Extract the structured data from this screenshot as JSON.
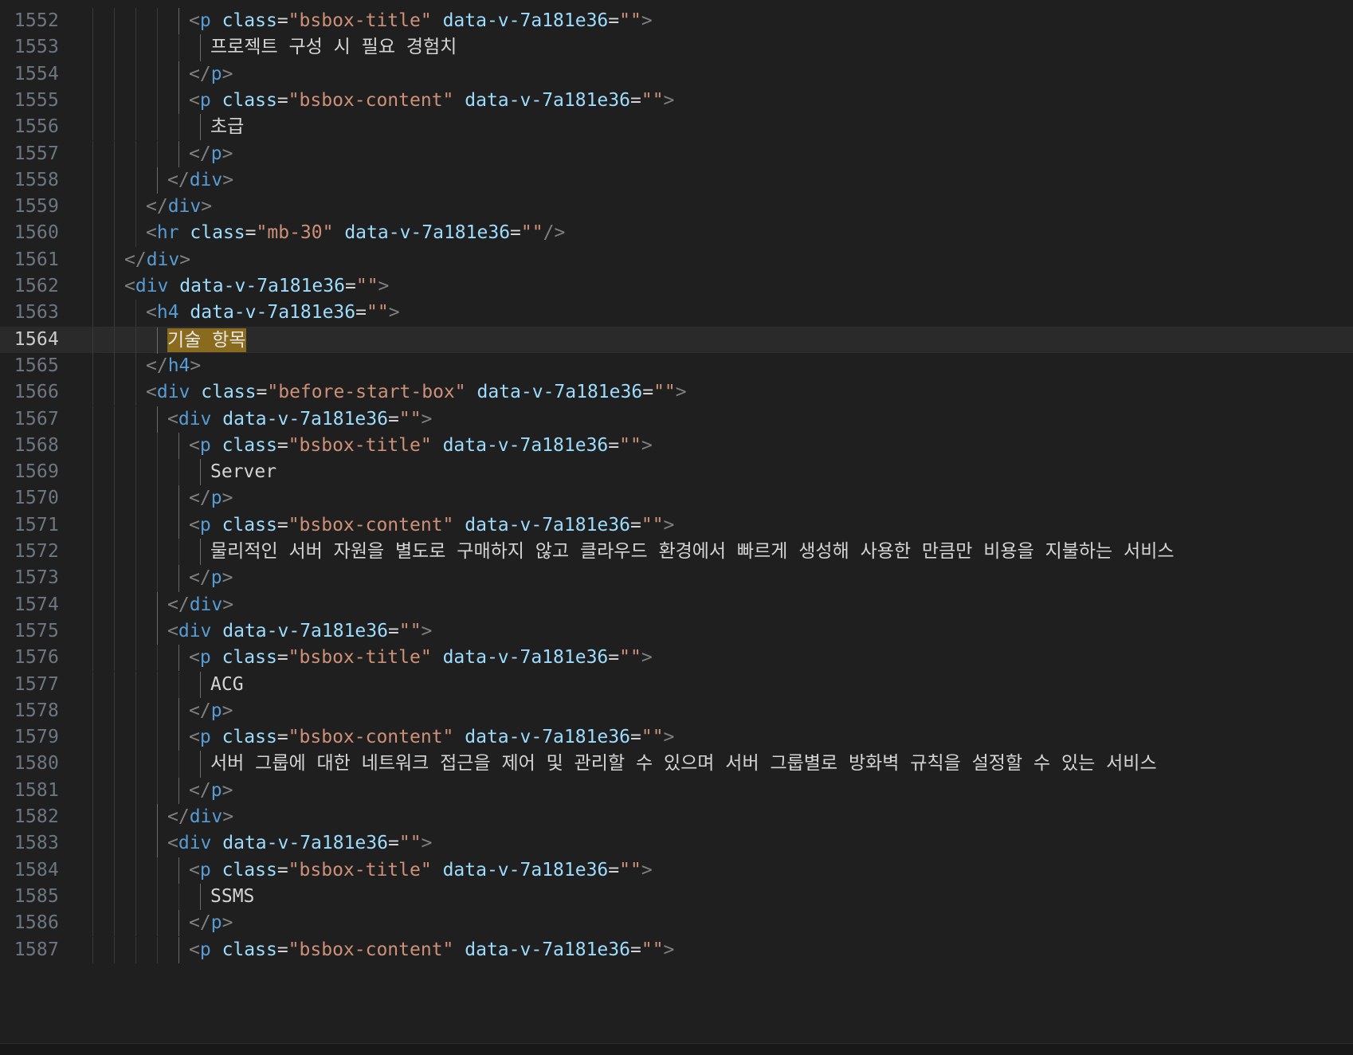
{
  "editor": {
    "current_line": 1564,
    "selected_text": "기술 항목",
    "lines": [
      {
        "num": "1552",
        "indent": 5,
        "tokens": [
          [
            "<",
            "punc"
          ],
          [
            "p",
            "tag"
          ],
          [
            " ",
            "text"
          ],
          [
            "class",
            "attr"
          ],
          [
            "=",
            "eq"
          ],
          [
            "\"bsbox-title\"",
            "str"
          ],
          [
            " ",
            "text"
          ],
          [
            "data-v-7a181e36",
            "attr"
          ],
          [
            "=",
            "eq"
          ],
          [
            "\"\"",
            "str"
          ],
          [
            ">",
            "punc"
          ]
        ]
      },
      {
        "num": "1553",
        "indent": 6,
        "tokens": [
          [
            "프로젝트 구성 시 필요 경험치",
            "text"
          ]
        ]
      },
      {
        "num": "1554",
        "indent": 5,
        "tokens": [
          [
            "</",
            "punc"
          ],
          [
            "p",
            "tag"
          ],
          [
            ">",
            "punc"
          ]
        ]
      },
      {
        "num": "1555",
        "indent": 5,
        "tokens": [
          [
            "<",
            "punc"
          ],
          [
            "p",
            "tag"
          ],
          [
            " ",
            "text"
          ],
          [
            "class",
            "attr"
          ],
          [
            "=",
            "eq"
          ],
          [
            "\"bsbox-content\"",
            "str"
          ],
          [
            " ",
            "text"
          ],
          [
            "data-v-7a181e36",
            "attr"
          ],
          [
            "=",
            "eq"
          ],
          [
            "\"\"",
            "str"
          ],
          [
            ">",
            "punc"
          ]
        ]
      },
      {
        "num": "1556",
        "indent": 6,
        "tokens": [
          [
            "초급",
            "text"
          ]
        ]
      },
      {
        "num": "1557",
        "indent": 5,
        "tokens": [
          [
            "</",
            "punc"
          ],
          [
            "p",
            "tag"
          ],
          [
            ">",
            "punc"
          ]
        ]
      },
      {
        "num": "1558",
        "indent": 4,
        "tokens": [
          [
            "</",
            "punc"
          ],
          [
            "div",
            "tag"
          ],
          [
            ">",
            "punc"
          ]
        ]
      },
      {
        "num": "1559",
        "indent": 3,
        "tokens": [
          [
            "</",
            "punc"
          ],
          [
            "div",
            "tag"
          ],
          [
            ">",
            "punc"
          ]
        ]
      },
      {
        "num": "1560",
        "indent": 3,
        "tokens": [
          [
            "<",
            "punc"
          ],
          [
            "hr",
            "tag"
          ],
          [
            " ",
            "text"
          ],
          [
            "class",
            "attr"
          ],
          [
            "=",
            "eq"
          ],
          [
            "\"mb-30\"",
            "str"
          ],
          [
            " ",
            "text"
          ],
          [
            "data-v-7a181e36",
            "attr"
          ],
          [
            "=",
            "eq"
          ],
          [
            "\"\"",
            "str"
          ],
          [
            "/>",
            "punc"
          ]
        ]
      },
      {
        "num": "1561",
        "indent": 2,
        "tokens": [
          [
            "</",
            "punc"
          ],
          [
            "div",
            "tag"
          ],
          [
            ">",
            "punc"
          ]
        ]
      },
      {
        "num": "1562",
        "indent": 2,
        "tokens": [
          [
            "<",
            "punc"
          ],
          [
            "div",
            "tag"
          ],
          [
            " ",
            "text"
          ],
          [
            "data-v-7a181e36",
            "attr"
          ],
          [
            "=",
            "eq"
          ],
          [
            "\"\"",
            "str"
          ],
          [
            ">",
            "punc"
          ]
        ]
      },
      {
        "num": "1563",
        "indent": 3,
        "tokens": [
          [
            "<",
            "punc"
          ],
          [
            "h4",
            "tag"
          ],
          [
            " ",
            "text"
          ],
          [
            "data-v-7a181e36",
            "attr"
          ],
          [
            "=",
            "eq"
          ],
          [
            "\"\"",
            "str"
          ],
          [
            ">",
            "punc"
          ]
        ]
      },
      {
        "num": "1564",
        "indent": 4,
        "tokens": [
          [
            "기술 항목",
            "hl"
          ]
        ]
      },
      {
        "num": "1565",
        "indent": 3,
        "tokens": [
          [
            "</",
            "punc"
          ],
          [
            "h4",
            "tag"
          ],
          [
            ">",
            "punc"
          ]
        ]
      },
      {
        "num": "1566",
        "indent": 3,
        "tokens": [
          [
            "<",
            "punc"
          ],
          [
            "div",
            "tag"
          ],
          [
            " ",
            "text"
          ],
          [
            "class",
            "attr"
          ],
          [
            "=",
            "eq"
          ],
          [
            "\"before-start-box\"",
            "str"
          ],
          [
            " ",
            "text"
          ],
          [
            "data-v-7a181e36",
            "attr"
          ],
          [
            "=",
            "eq"
          ],
          [
            "\"\"",
            "str"
          ],
          [
            ">",
            "punc"
          ]
        ]
      },
      {
        "num": "1567",
        "indent": 4,
        "tokens": [
          [
            "<",
            "punc"
          ],
          [
            "div",
            "tag"
          ],
          [
            " ",
            "text"
          ],
          [
            "data-v-7a181e36",
            "attr"
          ],
          [
            "=",
            "eq"
          ],
          [
            "\"\"",
            "str"
          ],
          [
            ">",
            "punc"
          ]
        ]
      },
      {
        "num": "1568",
        "indent": 5,
        "tokens": [
          [
            "<",
            "punc"
          ],
          [
            "p",
            "tag"
          ],
          [
            " ",
            "text"
          ],
          [
            "class",
            "attr"
          ],
          [
            "=",
            "eq"
          ],
          [
            "\"bsbox-title\"",
            "str"
          ],
          [
            " ",
            "text"
          ],
          [
            "data-v-7a181e36",
            "attr"
          ],
          [
            "=",
            "eq"
          ],
          [
            "\"\"",
            "str"
          ],
          [
            ">",
            "punc"
          ]
        ]
      },
      {
        "num": "1569",
        "indent": 6,
        "tokens": [
          [
            "Server",
            "text"
          ]
        ]
      },
      {
        "num": "1570",
        "indent": 5,
        "tokens": [
          [
            "</",
            "punc"
          ],
          [
            "p",
            "tag"
          ],
          [
            ">",
            "punc"
          ]
        ]
      },
      {
        "num": "1571",
        "indent": 5,
        "tokens": [
          [
            "<",
            "punc"
          ],
          [
            "p",
            "tag"
          ],
          [
            " ",
            "text"
          ],
          [
            "class",
            "attr"
          ],
          [
            "=",
            "eq"
          ],
          [
            "\"bsbox-content\"",
            "str"
          ],
          [
            " ",
            "text"
          ],
          [
            "data-v-7a181e36",
            "attr"
          ],
          [
            "=",
            "eq"
          ],
          [
            "\"\"",
            "str"
          ],
          [
            ">",
            "punc"
          ]
        ]
      },
      {
        "num": "1572",
        "indent": 6,
        "tokens": [
          [
            "물리적인 서버 자원을 별도로 구매하지 않고 클라우드 환경에서 빠르게 생성해 사용한 만큼만 비용을 지불하는 서비스",
            "text"
          ]
        ]
      },
      {
        "num": "1573",
        "indent": 5,
        "tokens": [
          [
            "</",
            "punc"
          ],
          [
            "p",
            "tag"
          ],
          [
            ">",
            "punc"
          ]
        ]
      },
      {
        "num": "1574",
        "indent": 4,
        "tokens": [
          [
            "</",
            "punc"
          ],
          [
            "div",
            "tag"
          ],
          [
            ">",
            "punc"
          ]
        ]
      },
      {
        "num": "1575",
        "indent": 4,
        "tokens": [
          [
            "<",
            "punc"
          ],
          [
            "div",
            "tag"
          ],
          [
            " ",
            "text"
          ],
          [
            "data-v-7a181e36",
            "attr"
          ],
          [
            "=",
            "eq"
          ],
          [
            "\"\"",
            "str"
          ],
          [
            ">",
            "punc"
          ]
        ]
      },
      {
        "num": "1576",
        "indent": 5,
        "tokens": [
          [
            "<",
            "punc"
          ],
          [
            "p",
            "tag"
          ],
          [
            " ",
            "text"
          ],
          [
            "class",
            "attr"
          ],
          [
            "=",
            "eq"
          ],
          [
            "\"bsbox-title\"",
            "str"
          ],
          [
            " ",
            "text"
          ],
          [
            "data-v-7a181e36",
            "attr"
          ],
          [
            "=",
            "eq"
          ],
          [
            "\"\"",
            "str"
          ],
          [
            ">",
            "punc"
          ]
        ]
      },
      {
        "num": "1577",
        "indent": 6,
        "tokens": [
          [
            "ACG",
            "text"
          ]
        ]
      },
      {
        "num": "1578",
        "indent": 5,
        "tokens": [
          [
            "</",
            "punc"
          ],
          [
            "p",
            "tag"
          ],
          [
            ">",
            "punc"
          ]
        ]
      },
      {
        "num": "1579",
        "indent": 5,
        "tokens": [
          [
            "<",
            "punc"
          ],
          [
            "p",
            "tag"
          ],
          [
            " ",
            "text"
          ],
          [
            "class",
            "attr"
          ],
          [
            "=",
            "eq"
          ],
          [
            "\"bsbox-content\"",
            "str"
          ],
          [
            " ",
            "text"
          ],
          [
            "data-v-7a181e36",
            "attr"
          ],
          [
            "=",
            "eq"
          ],
          [
            "\"\"",
            "str"
          ],
          [
            ">",
            "punc"
          ]
        ]
      },
      {
        "num": "1580",
        "indent": 6,
        "tokens": [
          [
            "서버 그룹에 대한 네트워크 접근을 제어 및 관리할 수 있으며 서버 그룹별로 방화벽 규칙을 설정할 수 있는 서비스",
            "text"
          ]
        ]
      },
      {
        "num": "1581",
        "indent": 5,
        "tokens": [
          [
            "</",
            "punc"
          ],
          [
            "p",
            "tag"
          ],
          [
            ">",
            "punc"
          ]
        ]
      },
      {
        "num": "1582",
        "indent": 4,
        "tokens": [
          [
            "</",
            "punc"
          ],
          [
            "div",
            "tag"
          ],
          [
            ">",
            "punc"
          ]
        ]
      },
      {
        "num": "1583",
        "indent": 4,
        "tokens": [
          [
            "<",
            "punc"
          ],
          [
            "div",
            "tag"
          ],
          [
            " ",
            "text"
          ],
          [
            "data-v-7a181e36",
            "attr"
          ],
          [
            "=",
            "eq"
          ],
          [
            "\"\"",
            "str"
          ],
          [
            ">",
            "punc"
          ]
        ]
      },
      {
        "num": "1584",
        "indent": 5,
        "tokens": [
          [
            "<",
            "punc"
          ],
          [
            "p",
            "tag"
          ],
          [
            " ",
            "text"
          ],
          [
            "class",
            "attr"
          ],
          [
            "=",
            "eq"
          ],
          [
            "\"bsbox-title\"",
            "str"
          ],
          [
            " ",
            "text"
          ],
          [
            "data-v-7a181e36",
            "attr"
          ],
          [
            "=",
            "eq"
          ],
          [
            "\"\"",
            "str"
          ],
          [
            ">",
            "punc"
          ]
        ]
      },
      {
        "num": "1585",
        "indent": 6,
        "tokens": [
          [
            "SSMS",
            "text"
          ]
        ]
      },
      {
        "num": "1586",
        "indent": 5,
        "tokens": [
          [
            "</",
            "punc"
          ],
          [
            "p",
            "tag"
          ],
          [
            ">",
            "punc"
          ]
        ]
      },
      {
        "num": "1587",
        "indent": 5,
        "tokens": [
          [
            "<",
            "punc"
          ],
          [
            "p",
            "tag"
          ],
          [
            " ",
            "text"
          ],
          [
            "class",
            "attr"
          ],
          [
            "=",
            "eq"
          ],
          [
            "\"bsbox-content\"",
            "str"
          ],
          [
            " ",
            "text"
          ],
          [
            "data-v-7a181e36",
            "attr"
          ],
          [
            "=",
            "eq"
          ],
          [
            "\"\"",
            "str"
          ],
          [
            ">",
            "punc"
          ]
        ]
      }
    ]
  }
}
